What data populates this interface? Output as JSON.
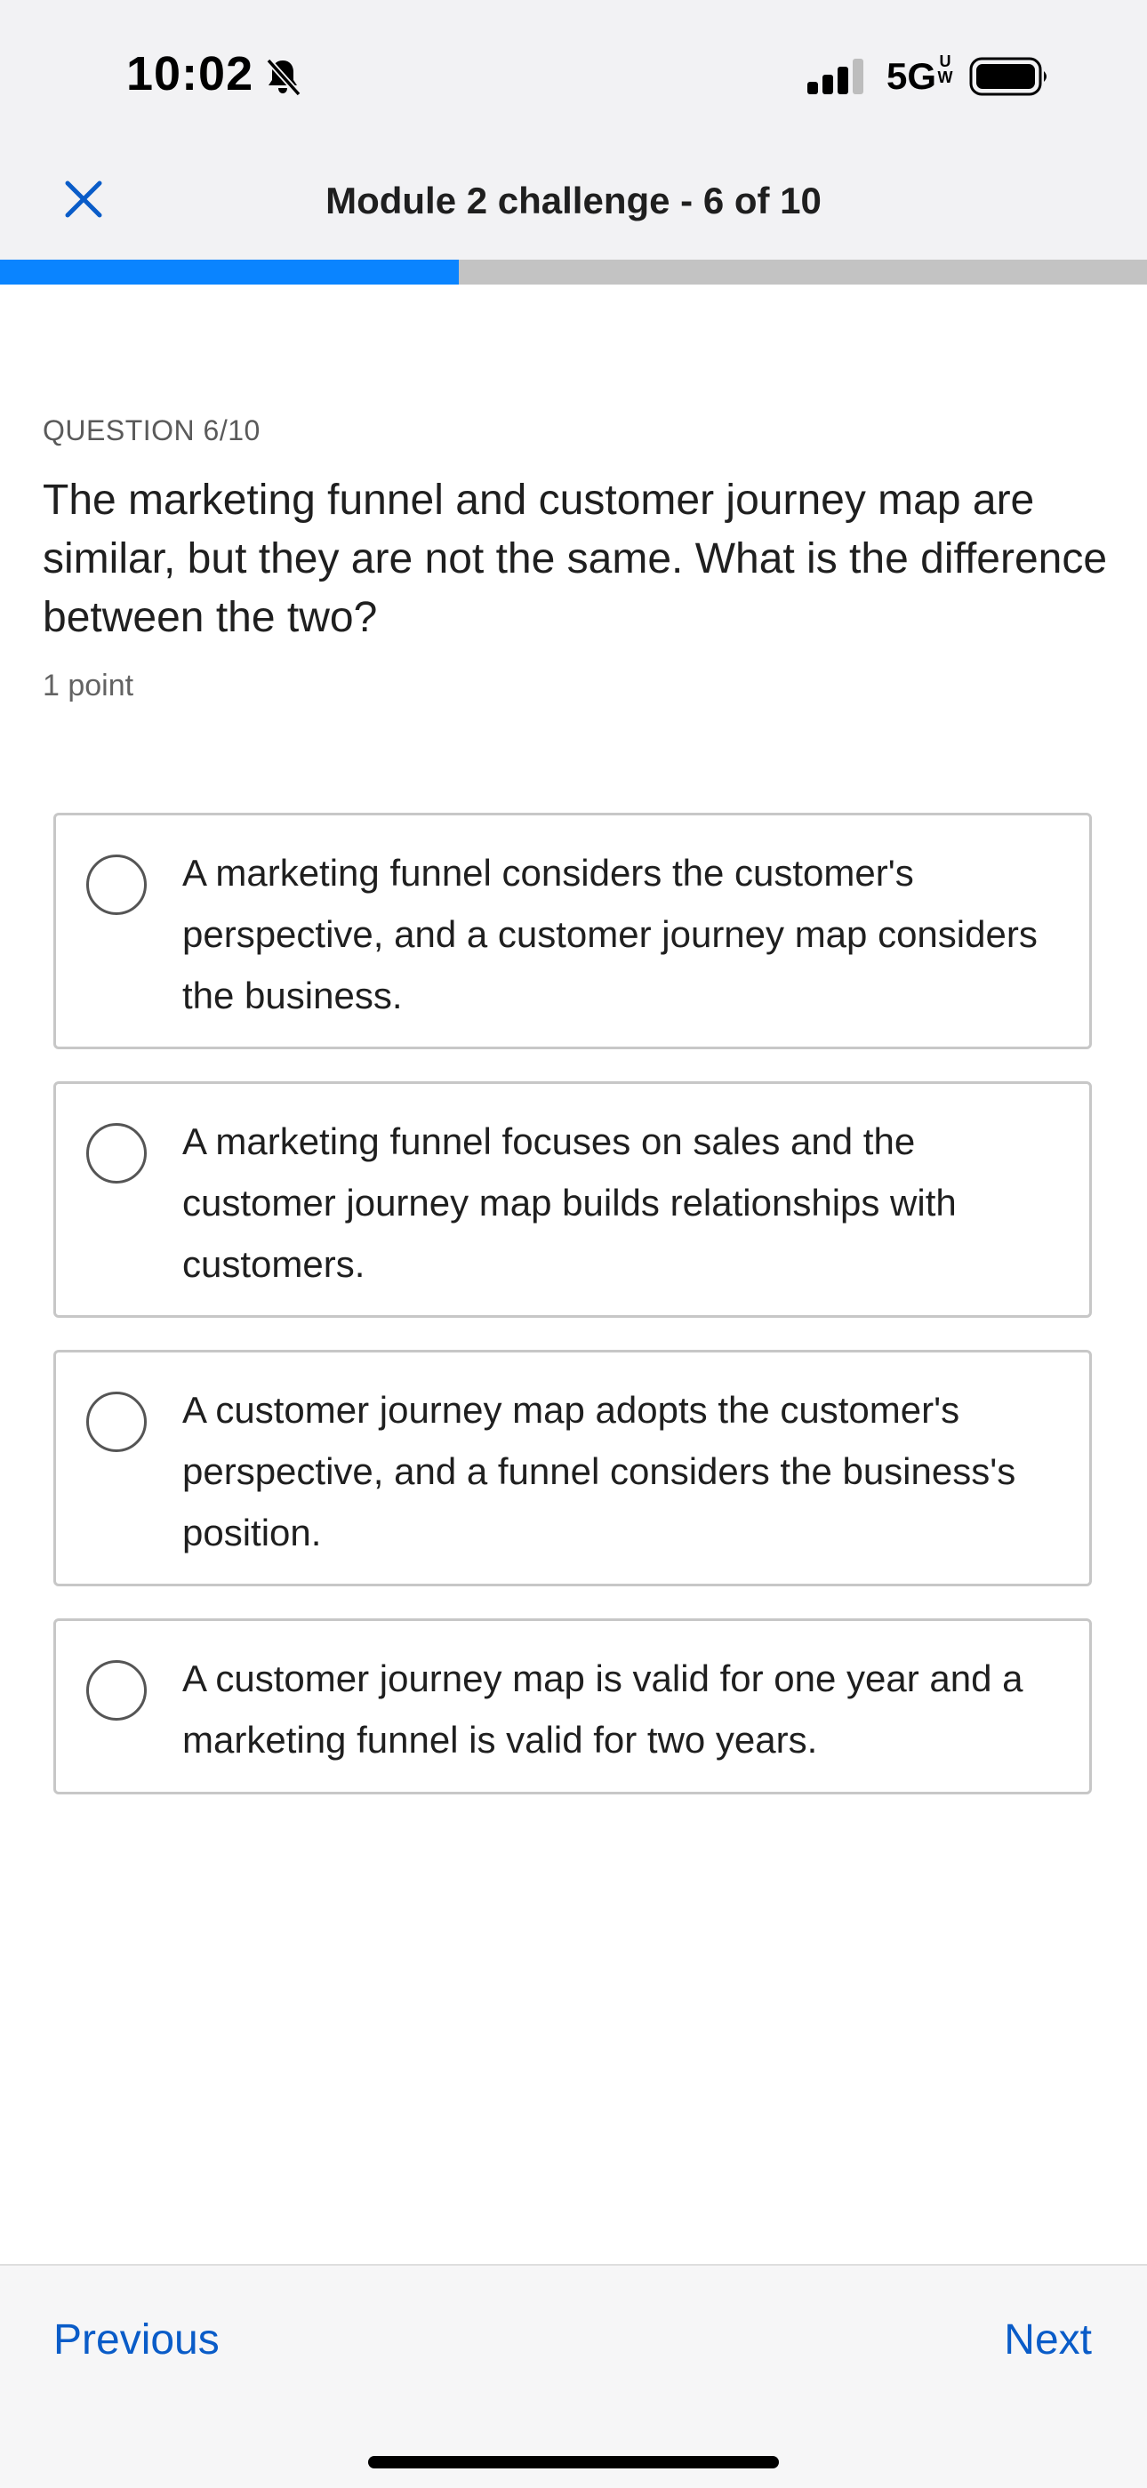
{
  "status_bar": {
    "time": "10:02",
    "network": "5G",
    "network_sub": "UW",
    "icons": [
      "bell-slash-icon",
      "signal-icon",
      "battery-icon"
    ]
  },
  "header": {
    "close_icon": "close-icon",
    "title": "Module 2 challenge  - 6 of 10",
    "progress_fraction": 0.4
  },
  "question": {
    "label": "QUESTION 6/10",
    "text": "The marketing funnel and customer journey map are similar, but they are not the same. What is the difference between the two?",
    "points": "1 point"
  },
  "options": [
    {
      "text": "A marketing funnel considers the customer's perspective, and a customer journey map considers the business.",
      "selected": false
    },
    {
      "text": "A marketing funnel focuses on sales and the customer journey map builds relationships with customers.",
      "selected": false
    },
    {
      "text": "A customer journey map adopts the customer's perspective, and a funnel considers the business's position.",
      "selected": false
    },
    {
      "text": "A customer journey map is valid for one year and a marketing funnel is valid for two years.",
      "selected": false
    }
  ],
  "navigation": {
    "previous_label": "Previous",
    "next_label": "Next"
  },
  "colors": {
    "accent": "#0a84ff",
    "link": "#0a5cc8"
  }
}
